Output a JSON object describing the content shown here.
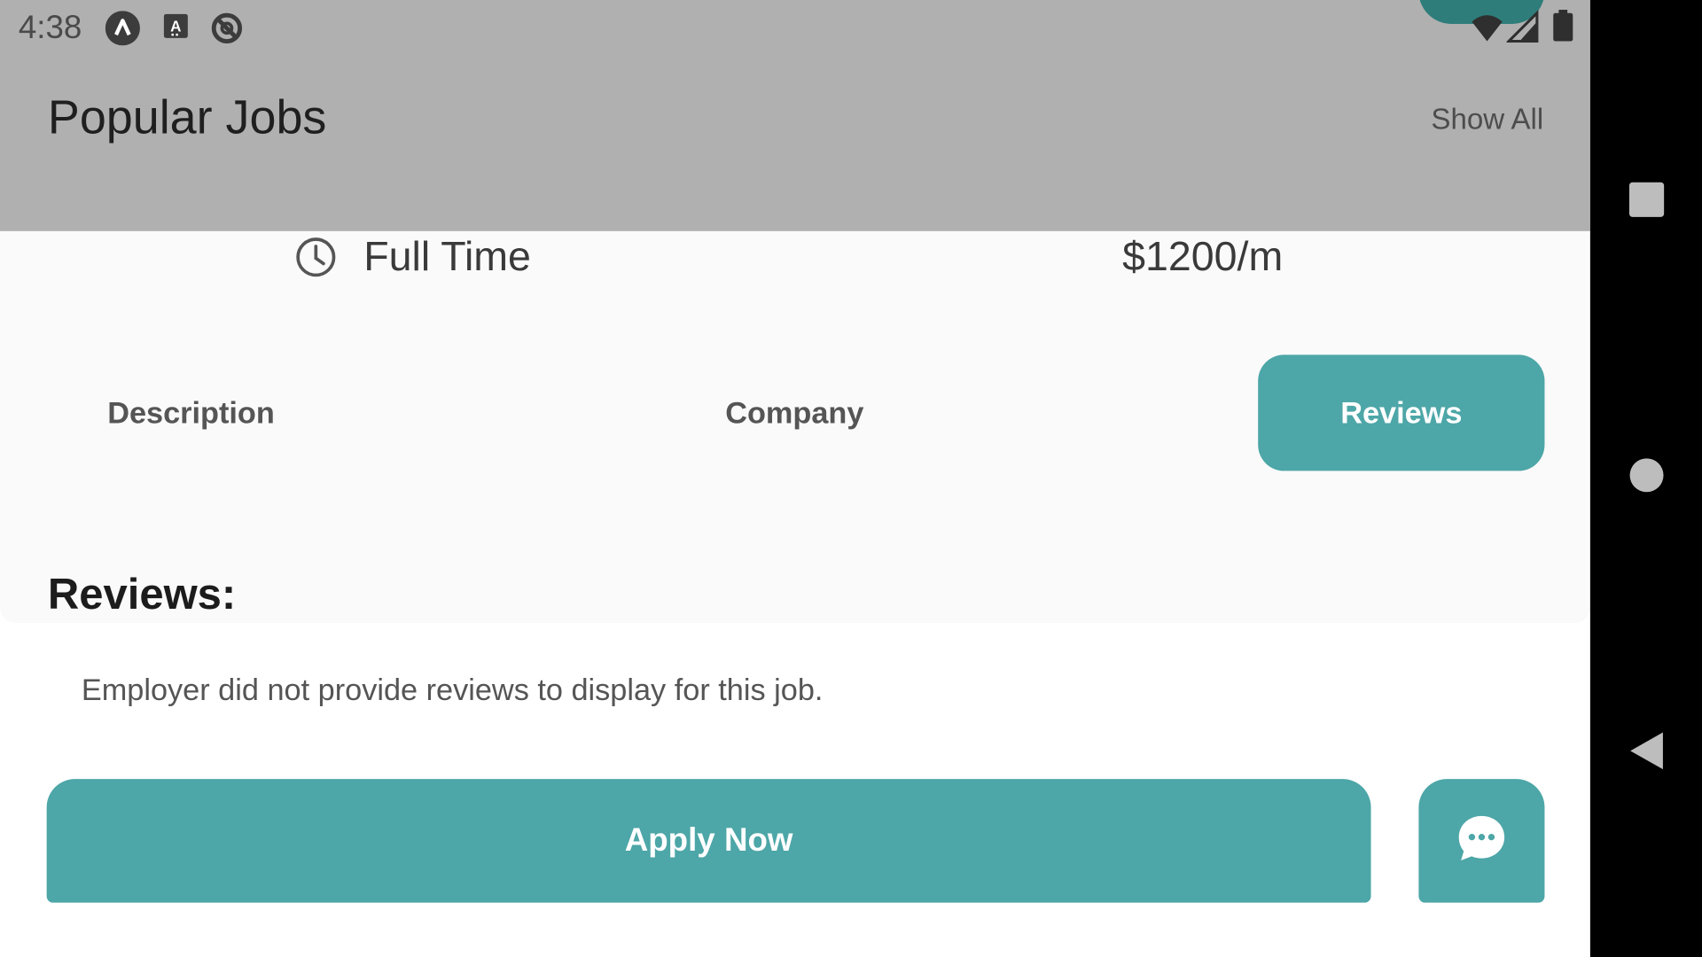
{
  "status_bar": {
    "time": "4:38",
    "notification_icons": [
      "app-icon",
      "accessibility-icon",
      "sync-disabled-icon"
    ],
    "right_icons": [
      "wifi-icon",
      "cellular-signal-icon",
      "battery-icon"
    ]
  },
  "header": {
    "title": "Popular Jobs",
    "show_all_label": "Show All"
  },
  "job_info": {
    "type_icon": "clock-icon",
    "job_type": "Full Time",
    "salary": "$1200/m"
  },
  "tabs": [
    {
      "label": "Description",
      "active": false
    },
    {
      "label": "Company",
      "active": false
    },
    {
      "label": "Reviews",
      "active": true
    }
  ],
  "reviews_section": {
    "title": "Reviews:",
    "body": "Employer did not provide reviews to display for this job."
  },
  "actions": {
    "apply_label": "Apply Now",
    "chat_icon": "chat-bubble-icon"
  },
  "nav_bar": {
    "buttons": [
      "recents-icon",
      "home-icon",
      "back-icon"
    ]
  },
  "colors": {
    "accent": "#4da6a7",
    "accent_dark": "#2e7d7a",
    "dim_overlay": "#b0b0b0",
    "sheet_background": "#fafafa"
  }
}
